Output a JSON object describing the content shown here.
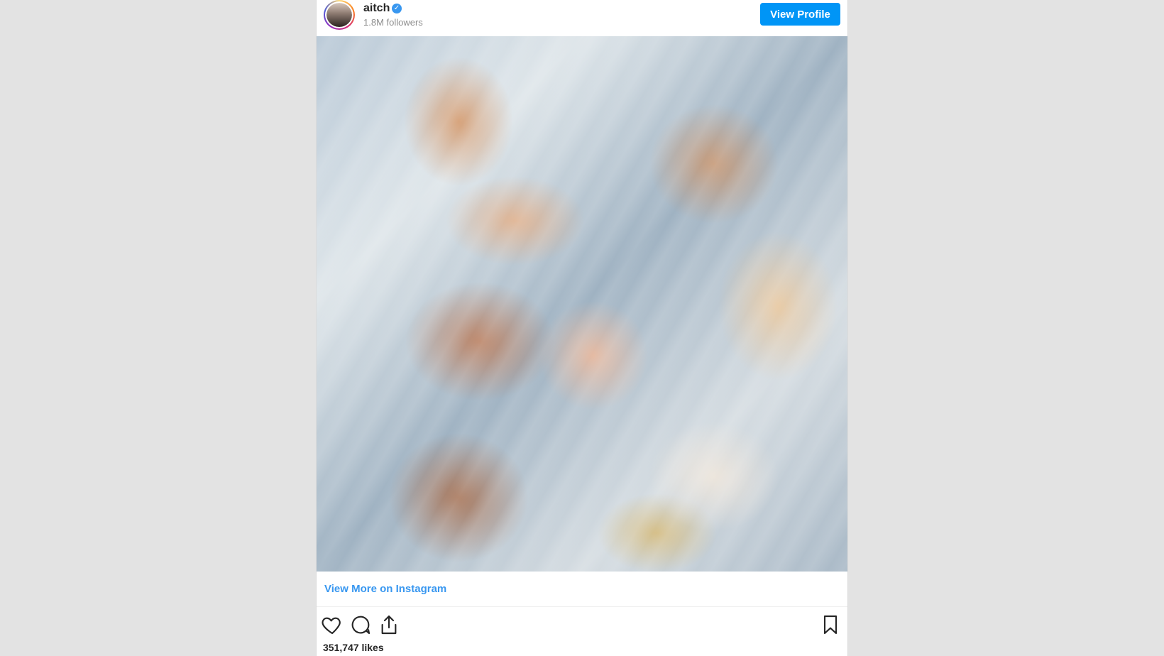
{
  "header": {
    "username": "aitch",
    "followers": "1.8M followers",
    "view_profile_label": "View Profile"
  },
  "post": {
    "view_more_label": "View More on Instagram",
    "likes": "351,747 likes"
  },
  "colors": {
    "accent": "#0095f6",
    "link": "#3897f0",
    "background": "#e3e3e3"
  },
  "icons": [
    "avatar",
    "verified-badge-icon",
    "heart-icon",
    "comment-icon",
    "share-icon",
    "bookmark-icon"
  ]
}
